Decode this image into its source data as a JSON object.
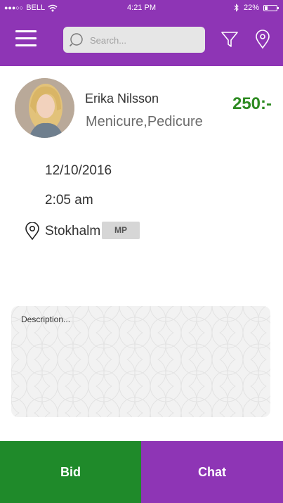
{
  "status_bar": {
    "carrier": "BELL",
    "signal_dots": "●●●○○",
    "time": "4:21 PM",
    "battery": "22%",
    "battery_level": 0.22,
    "icons": [
      "wifi-icon",
      "bluetooth-icon",
      "battery-icon"
    ]
  },
  "navbar": {
    "search_placeholder": "Search...",
    "icons": [
      "menu-icon",
      "search-icon",
      "filter-icon",
      "location-pin-icon"
    ],
    "background": "#8e35b5"
  },
  "profile": {
    "name": "Erika Nilsson",
    "service": "Menicure,Pedicure",
    "price": "250:-",
    "price_color": "#2e8b22"
  },
  "details": {
    "date": "12/10/2016",
    "time": "2:05 am",
    "location": "Stokhalm",
    "badge": "MP"
  },
  "description": {
    "placeholder": "Description..."
  },
  "actions": {
    "bid_label": "Bid",
    "chat_label": "Chat",
    "bid_color": "#1f8a2a",
    "chat_color": "#8e35b5"
  }
}
